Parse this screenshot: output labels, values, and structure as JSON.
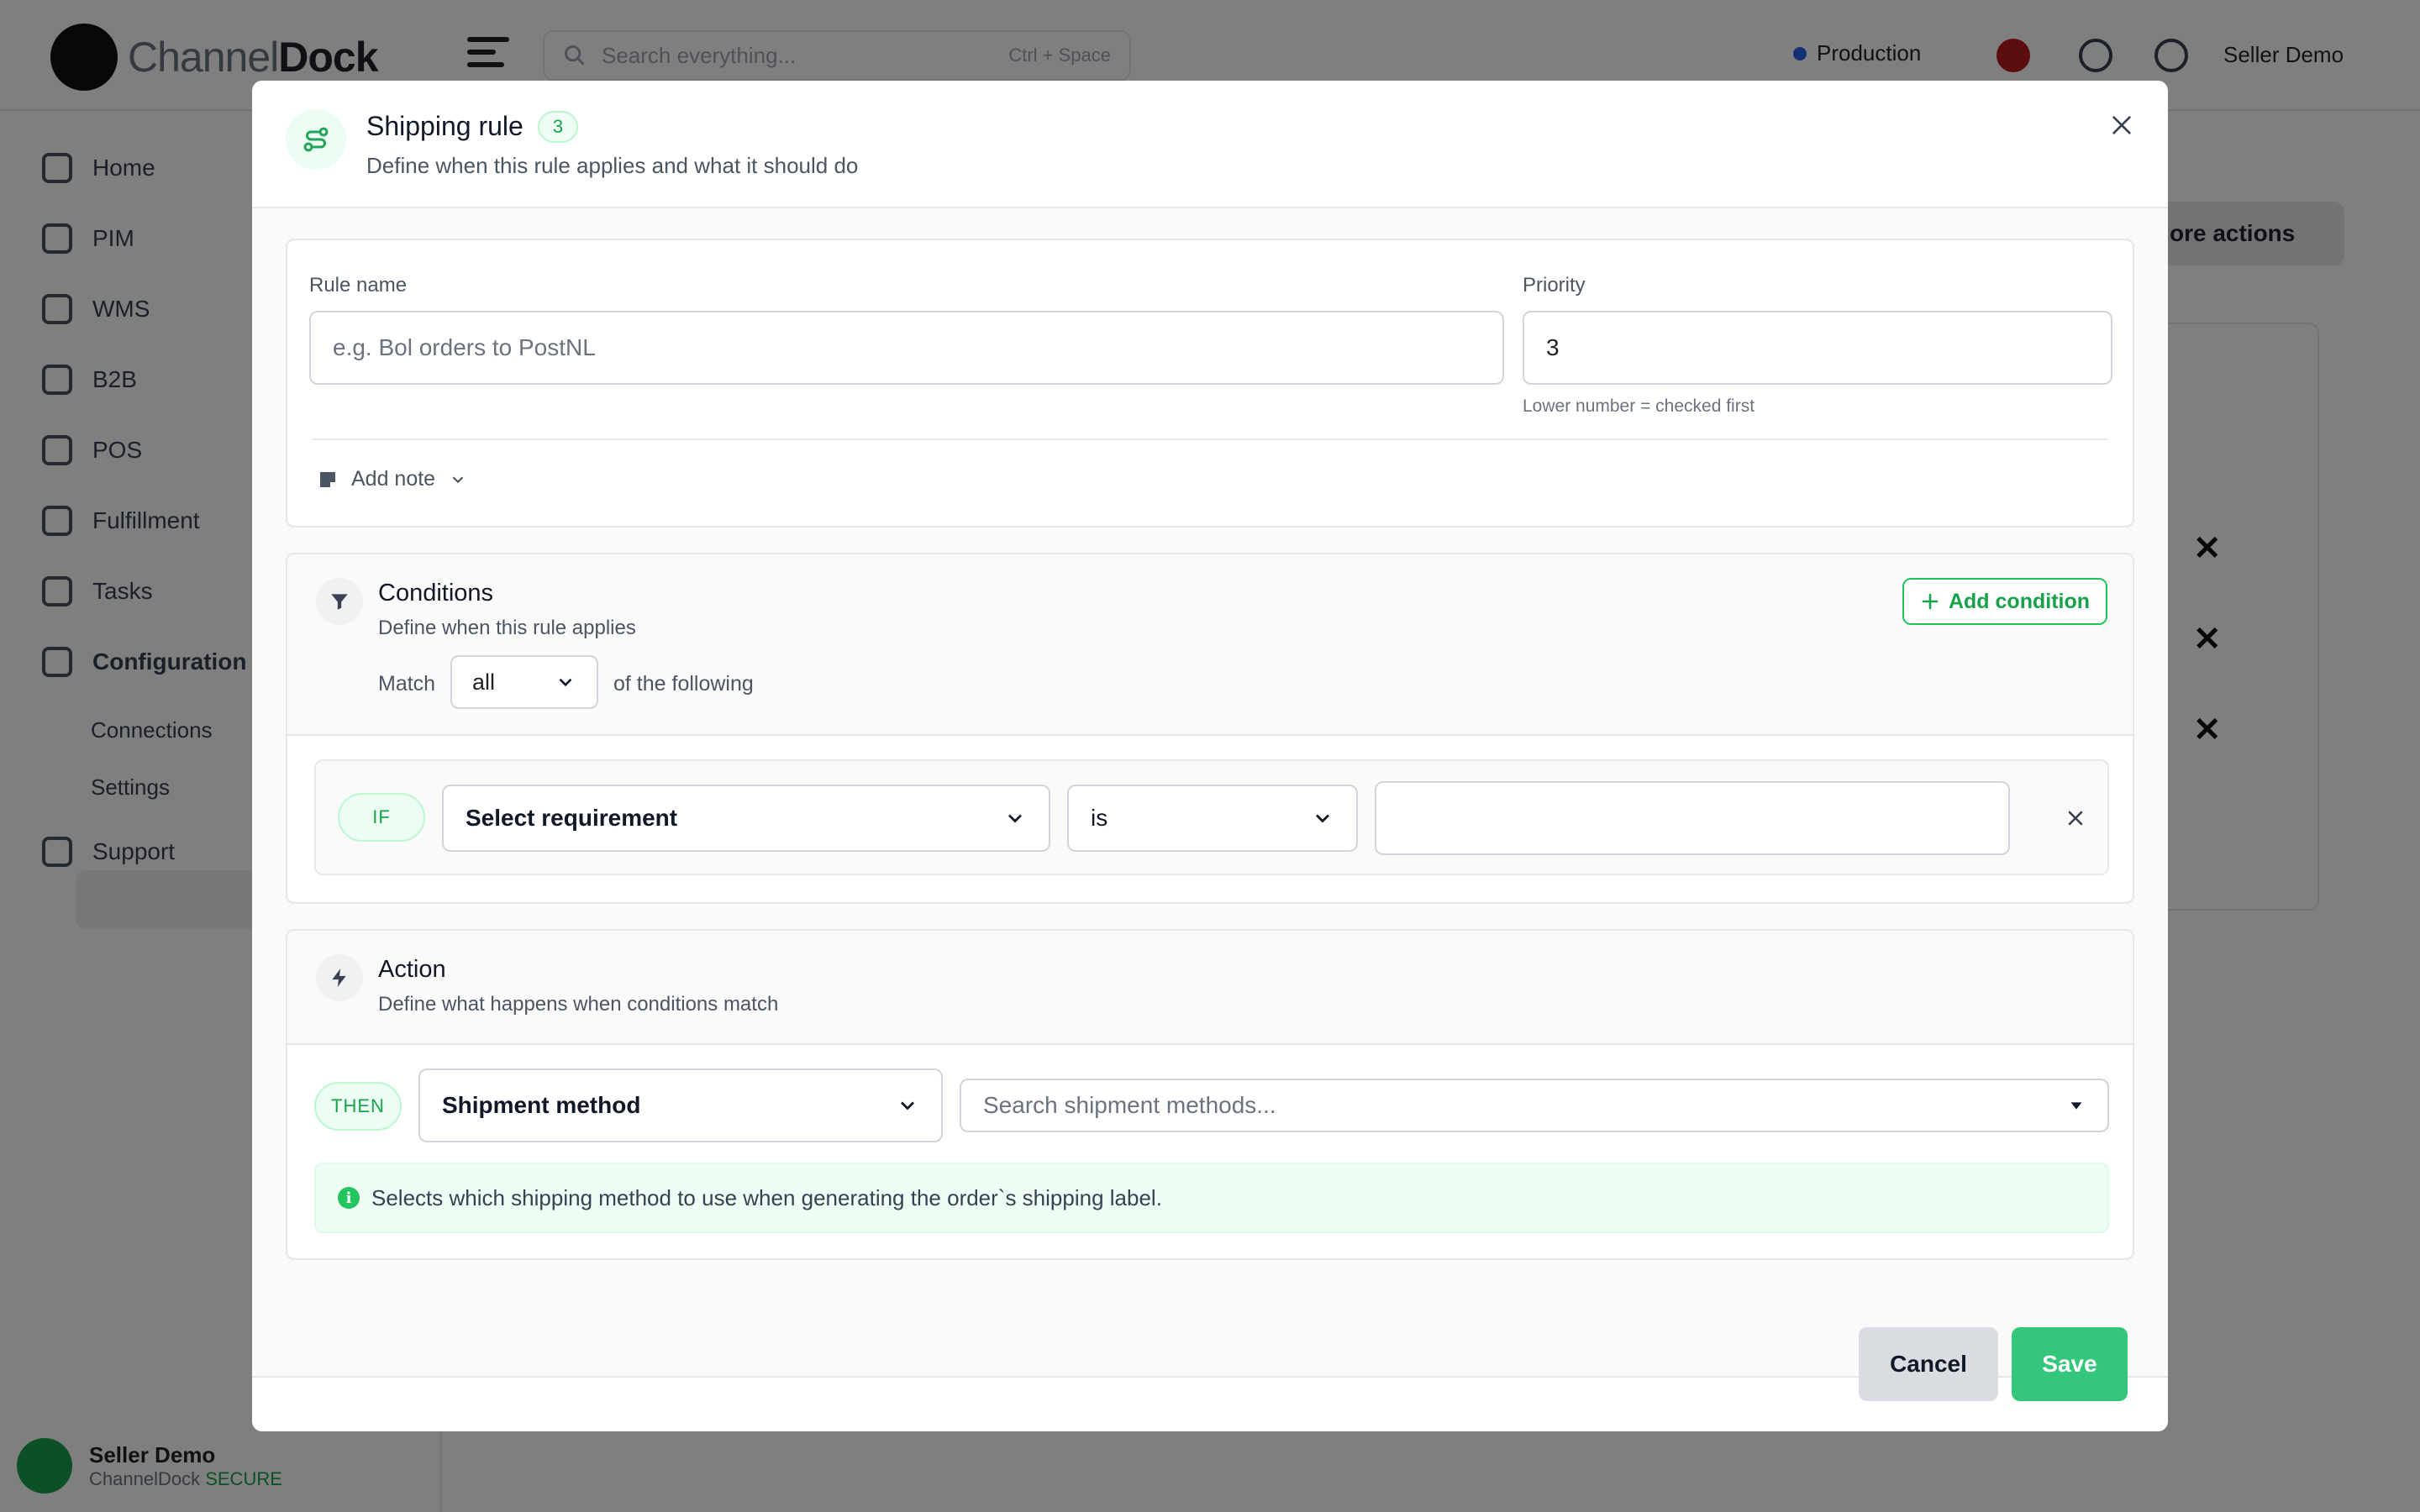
{
  "background": {
    "logo": {
      "word_bold_a": "Channel",
      "word_bold_b": "Dock"
    },
    "search_placeholder": "Search everything...",
    "search_kbd": "Ctrl + Space",
    "environment": "Production",
    "user_name": "Seller Demo",
    "nav": [
      "Home",
      "PIM",
      "WMS",
      "B2B",
      "POS",
      "Fulfillment",
      "Tasks",
      "Configuration"
    ],
    "sub_nav": [
      "Connections",
      "Settings"
    ],
    "support": "Support",
    "user_card": {
      "name": "Seller Demo",
      "company": "ChannelDock",
      "badge": "SECURE"
    },
    "more_actions": "More actions"
  },
  "modal": {
    "title": "Shipping rule",
    "badge": "3",
    "subtitle": "Define when this rule applies and what it should do",
    "rule_name": {
      "label": "Rule name",
      "placeholder": "e.g. Bol orders to PostNL",
      "value": ""
    },
    "priority": {
      "label": "Priority",
      "value": "3",
      "hint": "Lower number = checked first"
    },
    "add_note": "Add note",
    "conditions": {
      "title": "Conditions",
      "subtitle": "Define when this rule applies",
      "add_button": "Add condition",
      "match_label": "Match",
      "match_value": "all",
      "match_tail": "of the following",
      "row": {
        "if_label": "IF",
        "requirement": "Select requirement",
        "operator": "is",
        "value": ""
      }
    },
    "action": {
      "title": "Action",
      "subtitle": "Define what happens when conditions match",
      "then_label": "THEN",
      "action_type": "Shipment method",
      "search_placeholder": "Search shipment methods...",
      "info": "Selects which shipping method to use when generating the order`s shipping label."
    },
    "footer": {
      "cancel": "Cancel",
      "save": "Save"
    }
  },
  "colors": {
    "accent": "#34c77b",
    "accent_text": "#16a34a",
    "overlay": "rgba(0,0,0,0.5)"
  }
}
